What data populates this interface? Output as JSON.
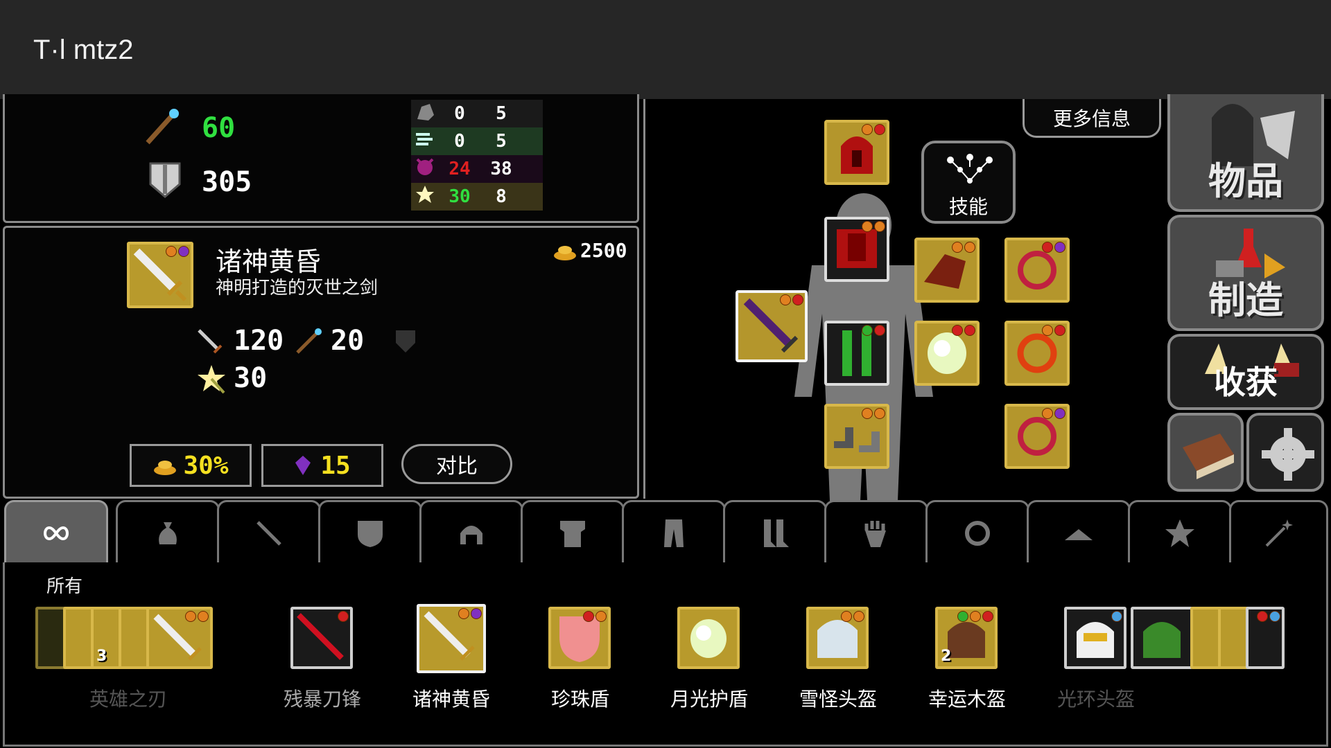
{
  "window": {
    "title": "T·l mtz2"
  },
  "stats": {
    "magic_value": "60",
    "armor_value": "305",
    "resources": [
      {
        "icon": "rock-icon",
        "current": "0",
        "max": "5"
      },
      {
        "icon": "wind-icon",
        "current": "0",
        "max": "5"
      },
      {
        "icon": "demon-icon",
        "current": "24",
        "max": "38"
      },
      {
        "icon": "holy-star-icon",
        "current": "30",
        "max": "8"
      }
    ]
  },
  "detail": {
    "name": "诸神黄昏",
    "description": "神明打造的灭世之剑",
    "price": "2500",
    "attack": "120",
    "magic": "20",
    "holy": "30",
    "gold_bonus": "30%",
    "gems": "15",
    "compare_label": "对比"
  },
  "equip": {
    "more_info_label": "更多信息",
    "skills_label": "技能"
  },
  "side_menu": {
    "items_label": "物品",
    "craft_label": "制造",
    "harvest_label": "收获"
  },
  "tabs": [
    {
      "icon": "infinity-icon"
    },
    {
      "icon": "bag-icon"
    },
    {
      "icon": "sword-icon"
    },
    {
      "icon": "shield-icon"
    },
    {
      "icon": "helmet-icon"
    },
    {
      "icon": "chest-armor-icon"
    },
    {
      "icon": "pants-icon"
    },
    {
      "icon": "boots-icon"
    },
    {
      "icon": "glove-icon"
    },
    {
      "icon": "ring-icon"
    },
    {
      "icon": "hat-icon"
    },
    {
      "icon": "star-icon"
    },
    {
      "icon": "wand-icon"
    }
  ],
  "list": {
    "heading": "所有",
    "items": [
      {
        "name": "英雄之刃",
        "count": "3"
      },
      {
        "name": "残暴刀锋"
      },
      {
        "name": "诸神黄昏"
      },
      {
        "name": "珍珠盾"
      },
      {
        "name": "月光护盾"
      },
      {
        "name": "雪怪头盔"
      },
      {
        "name": "幸运木盔",
        "count": "2"
      },
      {
        "name": "光环头盔"
      }
    ]
  },
  "colors": {
    "gold_frame": "#d8b84a",
    "green_text": "#30e040",
    "yellow_text": "#f5e020",
    "red_text": "#e02020"
  }
}
